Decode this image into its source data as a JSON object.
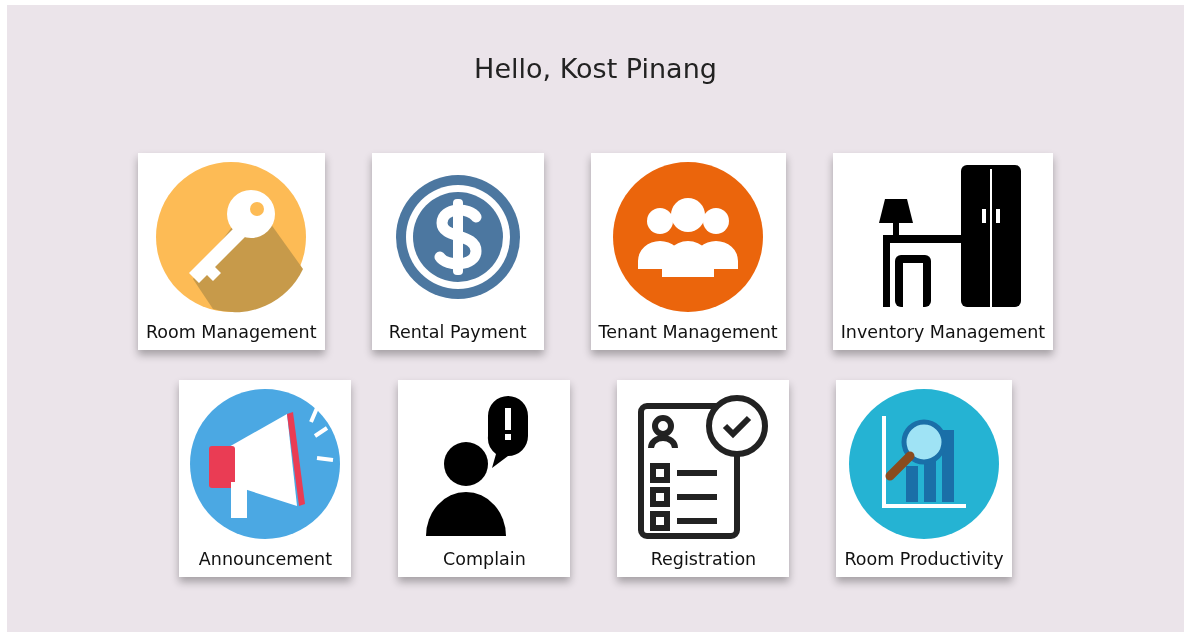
{
  "greeting": "Hello, Kost Pinang",
  "rows": [
    [
      {
        "label": "Room Management"
      },
      {
        "label": "Rental Payment"
      },
      {
        "label": "Tenant Management"
      },
      {
        "label": "Inventory Management"
      }
    ],
    [
      {
        "label": "Announcement"
      },
      {
        "label": "Complain"
      },
      {
        "label": "Registration"
      },
      {
        "label": "Room Productivity"
      }
    ]
  ]
}
